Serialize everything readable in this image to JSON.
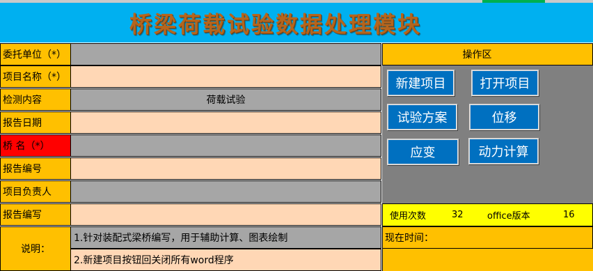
{
  "title": "桥梁荷载试验数据处理模块",
  "form": {
    "rows": [
      {
        "label": "委托单位（*）",
        "value": ""
      },
      {
        "label": "项目名称（*）",
        "value": ""
      },
      {
        "label": "检测内容",
        "value": "荷载试验"
      },
      {
        "label": "报告日期",
        "value": ""
      },
      {
        "label": "桥  名（*）",
        "value": ""
      },
      {
        "label": "报告编号",
        "value": ""
      },
      {
        "label": "项目负责人",
        "value": ""
      },
      {
        "label": "报告编写",
        "value": ""
      }
    ]
  },
  "notes": {
    "label": "说明：",
    "lines": [
      "1.针对装配式梁桥编写，用于辅助计算、图表绘制",
      "2.新建项目按钮回关闭所有word程序"
    ]
  },
  "panel": {
    "header": "操作区",
    "buttons": {
      "new_project": "新建项目",
      "open_project": "打开项目",
      "test_plan": "试验方案",
      "displacement": "位移",
      "strain": "应变",
      "dynamic": "动力计算"
    }
  },
  "stats": {
    "use_count_label": "使用次数",
    "use_count": "32",
    "office_label": "office版本",
    "office_version": "16"
  },
  "time": {
    "label": "现在时间："
  },
  "colors": {
    "title_band": "#00b0f0",
    "title_text": "#b5651d",
    "label_bg": "#ffc000",
    "required_label_bg": "#ff0000",
    "input_peach": "#ffd7b5",
    "input_gray": "#a6a6a6",
    "button_blue": "#0070c0",
    "panel_gray": "#808080",
    "stats_yellow": "#ffff00"
  }
}
